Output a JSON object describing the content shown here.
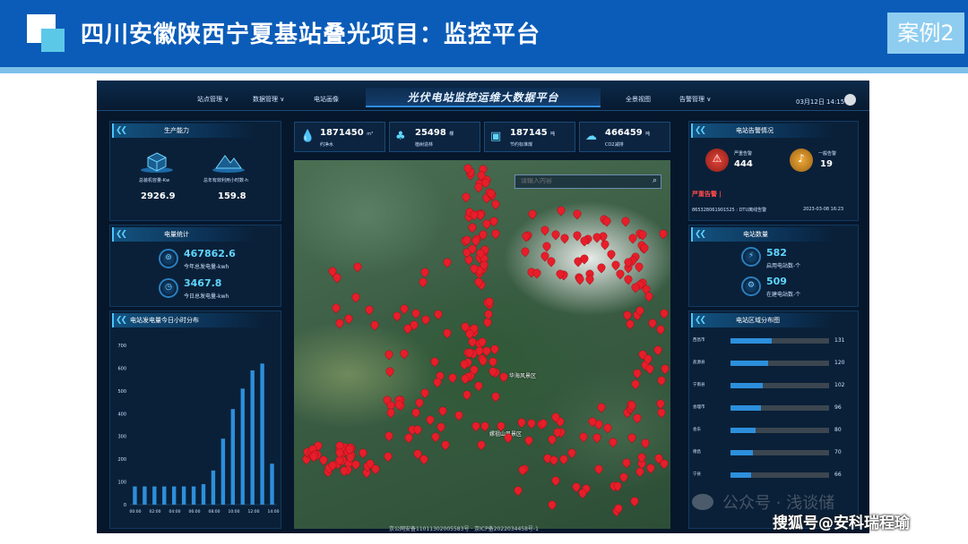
{
  "slide": {
    "title": "四川安徽陕西宁夏基站叠光项目：监控平台",
    "badge": "案例2"
  },
  "dashboard": {
    "title": "光伏电站监控运维大数据平台",
    "nav_left": [
      {
        "label": "站点管理",
        "chevron": "∨"
      },
      {
        "label": "数据管理",
        "chevron": "∨"
      },
      {
        "label": "电站画像",
        "chevron": ""
      }
    ],
    "nav_right": [
      {
        "label": "全景视图",
        "chevron": ""
      },
      {
        "label": "告警管理",
        "chevron": "∨"
      }
    ],
    "datetime": "03月12日 14:15"
  },
  "production": {
    "title": "生产能力",
    "items": [
      {
        "label": "总装机容量-Kw",
        "value": "2926.9",
        "icon": "cube-icon"
      },
      {
        "label": "总年有效利用小时数-h",
        "value": "159.8",
        "icon": "mountain-icon"
      }
    ]
  },
  "energy": {
    "title": "电量统计",
    "items": [
      {
        "value": "467862.6",
        "label": "今年总发电量-kwh",
        "icon": "chart-icon"
      },
      {
        "value": "3467.8",
        "label": "今日总发电量-kwh",
        "icon": "clock-icon"
      }
    ]
  },
  "kpis": [
    {
      "value": "1871450",
      "unit": "m³",
      "label": "约净水",
      "icon": "drop-icon"
    },
    {
      "value": "25498",
      "unit": "棵",
      "label": "植树造林",
      "icon": "tree-icon"
    },
    {
      "value": "187145",
      "unit": "吨",
      "label": "节约标准煤",
      "icon": "coal-icon"
    },
    {
      "value": "466459",
      "unit": "吨",
      "label": "CO2减排",
      "icon": "cloud-icon"
    }
  ],
  "map": {
    "search_placeholder": "请输入内容",
    "labels": [
      "华海风景区",
      "嫘祖山风景区"
    ],
    "footer": "京公网安备11011302005583号 · 京ICP备2022034458号-1"
  },
  "alarms": {
    "title": "电站告警情况",
    "severe": {
      "label": "严重告警",
      "value": "444"
    },
    "normal": {
      "label": "一般告警",
      "value": "19"
    },
    "section_title": "严重告警 |",
    "row": {
      "text": "865328061901525 : DTU离线告警",
      "time": "2023-03-08 16:23"
    }
  },
  "stations": {
    "title": "电站数量",
    "items": [
      {
        "value": "582",
        "label": "启用电站数-个",
        "icon": "plug-icon"
      },
      {
        "value": "509",
        "label": "在建电站数-个",
        "icon": "wrench-icon"
      }
    ]
  },
  "region_chart_title": "电站区域分布图",
  "hourly_chart_title": "电站发电量今日小时分布",
  "chart_data": [
    {
      "type": "bar",
      "title": "电站发电量今日小时分布",
      "categories": [
        "00:00",
        "02:00",
        "04:00",
        "06:00",
        "08:00",
        "10:00",
        "12:00",
        "14:00"
      ],
      "values": [
        80,
        80,
        80,
        80,
        80,
        80,
        80,
        90,
        150,
        290,
        420,
        510,
        590,
        620,
        180
      ],
      "ylim": [
        0,
        700
      ],
      "yticks": [
        "0",
        "100",
        "200",
        "300",
        "400",
        "500",
        "600",
        "700"
      ],
      "color": "#2d8fdc"
    },
    {
      "type": "bar",
      "title": "电站区域分布图",
      "orientation": "horizontal",
      "categories": [
        "西昌市",
        "盐源县",
        "宁南县",
        "会理市",
        "会东",
        "德昌",
        "宁县"
      ],
      "values": [
        131,
        120,
        102,
        96,
        80,
        70,
        66
      ],
      "value_labels": [
        "131",
        "120",
        "102",
        "96",
        "80",
        "70",
        "66"
      ],
      "xlim": [
        0,
        131
      ],
      "color": "#2d8fdc"
    }
  ],
  "watermark": {
    "line1": "公众号 · 浅谈储",
    "line2": "搜狐号@安科瑞程瑜"
  }
}
